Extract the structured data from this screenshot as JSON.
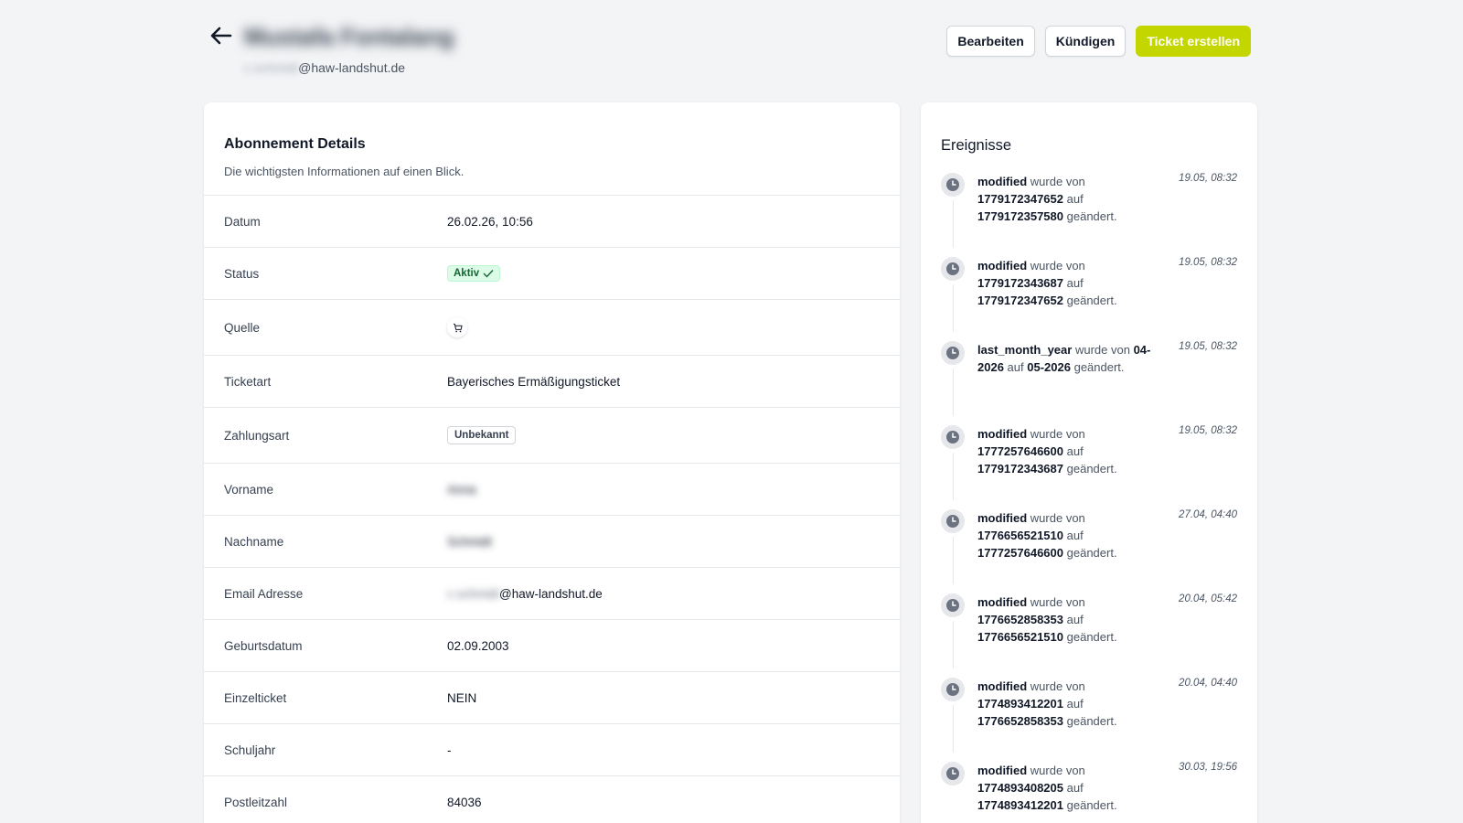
{
  "header": {
    "title_redacted": "Mustafa Fontalang",
    "email_redacted": "c.schmidt",
    "email_domain": "@haw-landshut.de"
  },
  "actions": {
    "edit": "Bearbeiten",
    "cancel": "Kündigen",
    "create_ticket": "Ticket erstellen"
  },
  "colors": {
    "primary": "#c4d600",
    "background": "#f3f4f6",
    "badge_green_bg": "#dcfce7",
    "badge_green_text": "#166534"
  },
  "details": {
    "title": "Abonnement Details",
    "subtitle": "Die wichtigsten Informationen auf einen Blick.",
    "rows": [
      {
        "label": "Datum",
        "value": "26.02.26, 10:56"
      },
      {
        "label": "Status",
        "value": "Aktiv"
      },
      {
        "label": "Quelle",
        "value": "",
        "icon": "cart-icon"
      },
      {
        "label": "Ticketart",
        "value": "Bayerisches Ermäßigungsticket"
      },
      {
        "label": "Zahlungsart",
        "value": "Unbekannt"
      },
      {
        "label": "Vorname",
        "value": "Anna"
      },
      {
        "label": "Nachname",
        "value": "Schmidt"
      },
      {
        "label": "Email Adresse",
        "value_redacted": "c.schmidt",
        "value_domain": "@haw-landshut.de"
      },
      {
        "label": "Geburtsdatum",
        "value": "02.09.2003"
      },
      {
        "label": "Einzelticket",
        "value": "NEIN"
      },
      {
        "label": "Schuljahr",
        "value": "-"
      },
      {
        "label": "Postleitzahl",
        "value": "84036"
      }
    ]
  },
  "events": {
    "title": "Ereignisse",
    "word_by": "wurde von",
    "word_to": "auf",
    "word_changed": "geändert.",
    "items": [
      {
        "field": "modified",
        "from": "1779172347652",
        "to": "1779172357580",
        "time": "19.05, 08:32"
      },
      {
        "field": "modified",
        "from": "1779172343687",
        "to": "1779172347652",
        "time": "19.05, 08:32"
      },
      {
        "field": "last_month_year",
        "from": "04-2026",
        "to": "05-2026",
        "time": "19.05, 08:32"
      },
      {
        "field": "modified",
        "from": "1777257646600",
        "to": "1779172343687",
        "time": "19.05, 08:32"
      },
      {
        "field": "modified",
        "from": "1776656521510",
        "to": "1777257646600",
        "time": "27.04, 04:40"
      },
      {
        "field": "modified",
        "from": "1776652858353",
        "to": "1776656521510",
        "time": "20.04, 05:42"
      },
      {
        "field": "modified",
        "from": "1774893412201",
        "to": "1776652858353",
        "time": "20.04, 04:40"
      },
      {
        "field": "modified",
        "from": "1774893408205",
        "to": "1774893412201",
        "time": "30.03, 19:56"
      }
    ]
  }
}
